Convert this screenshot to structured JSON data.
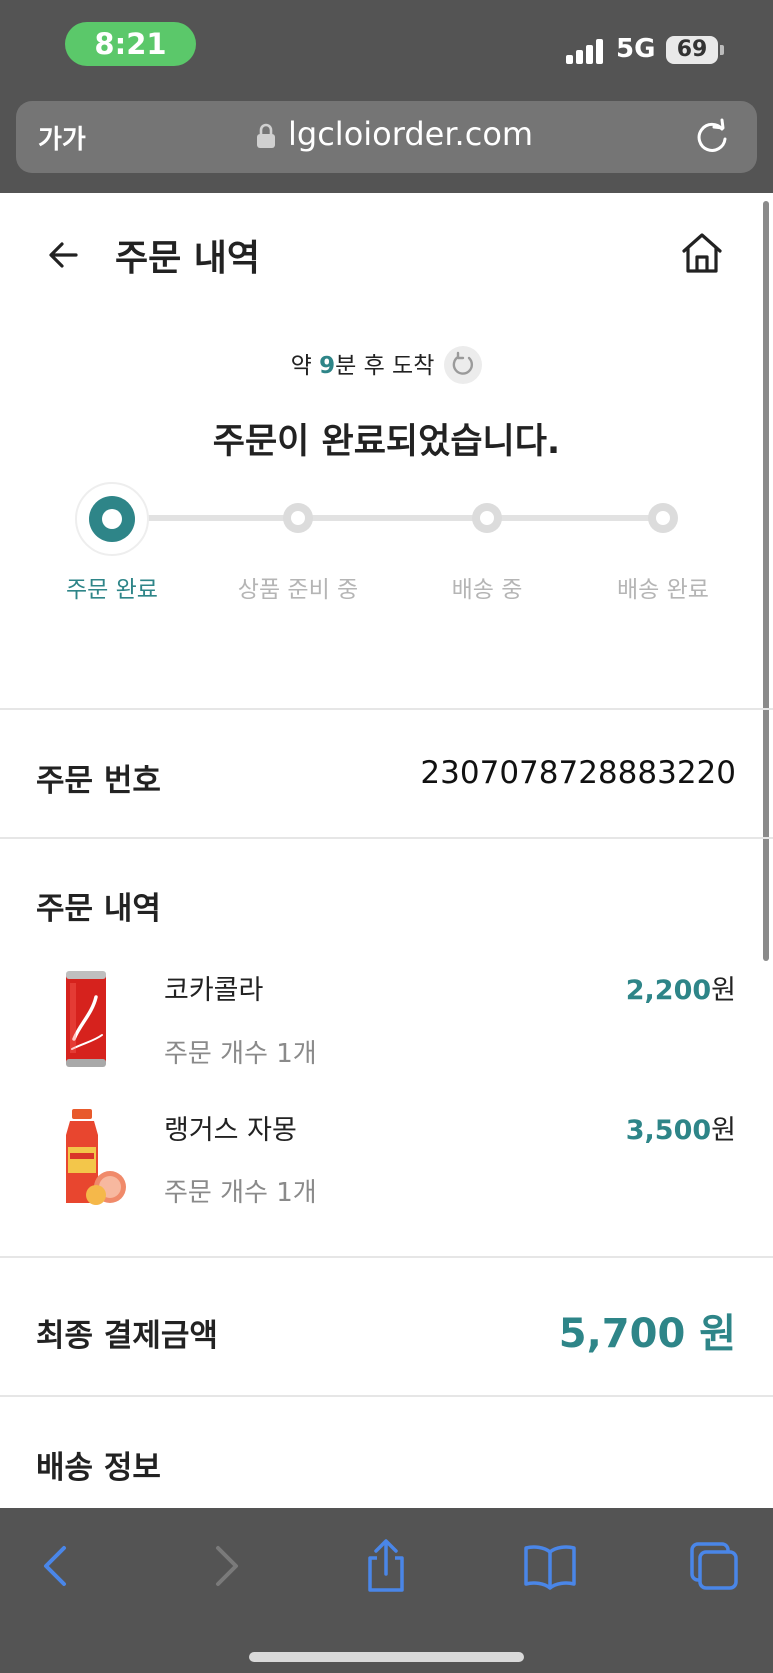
{
  "status_bar": {
    "time": "8:21",
    "network": "5G",
    "battery": "69",
    "time_pill_color": "#5bc86a"
  },
  "browser": {
    "text_size_label": "가가",
    "url": "lgcloiorder.com",
    "icons": [
      "lock-icon",
      "reload-icon"
    ]
  },
  "header": {
    "title": "주문 내역",
    "icons": [
      "back-arrow-icon",
      "home-icon"
    ]
  },
  "status": {
    "eta_prefix": "약 ",
    "eta_minutes": "9",
    "eta_suffix": "분 후 도착",
    "headline": "주문이 완료되었습니다.",
    "steps": [
      {
        "label": "주문 완료",
        "active": true
      },
      {
        "label": "상품 준비 중",
        "active": false
      },
      {
        "label": "배송 중",
        "active": false
      },
      {
        "label": "배송 완료",
        "active": false
      }
    ],
    "accent_color": "#2e8588"
  },
  "order": {
    "number_label": "주문 번호",
    "number_value": "2307078728883220",
    "items_label": "주문 내역",
    "items": [
      {
        "name": "코카콜라",
        "qty": "주문 개수 1개",
        "price": "2,200",
        "currency": "원"
      },
      {
        "name": "랭거스 자몽",
        "qty": "주문 개수 1개",
        "price": "3,500",
        "currency": "원"
      }
    ],
    "total_label": "최종 결제금액",
    "total_value": "5,700 원",
    "shipping_label": "배송 정보"
  },
  "toolbar": {
    "icons": [
      "back-icon",
      "forward-icon",
      "share-icon",
      "bookmarks-icon",
      "tabs-icon"
    ],
    "icon_color": "#4a86e8"
  }
}
